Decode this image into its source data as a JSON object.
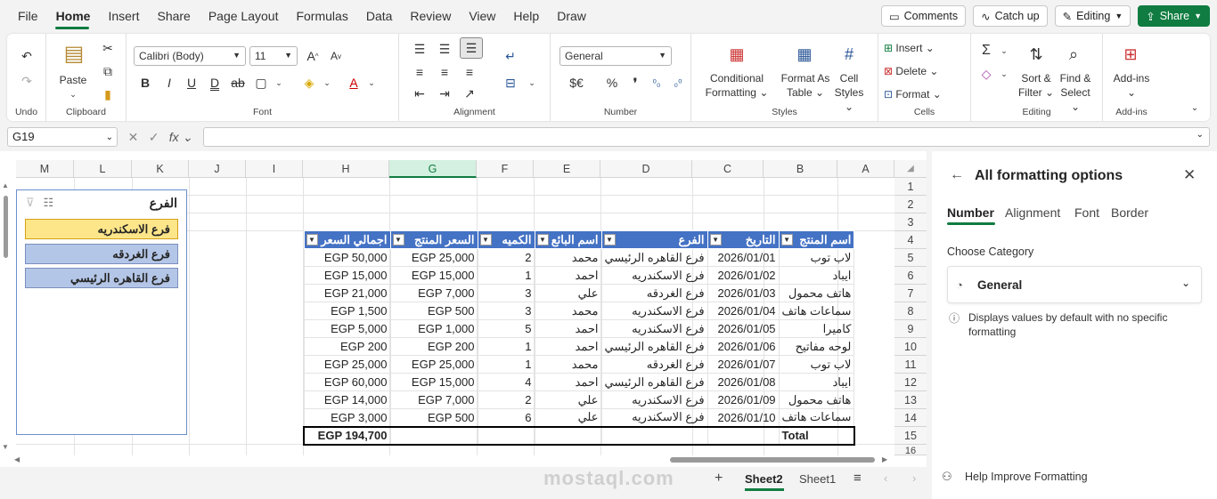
{
  "menu": [
    "File",
    "Home",
    "Insert",
    "Share",
    "Page Layout",
    "Formulas",
    "Data",
    "Review",
    "View",
    "Help",
    "Draw"
  ],
  "top_buttons": {
    "comments": "Comments",
    "catchup": "Catch up",
    "editing": "Editing",
    "share": "Share"
  },
  "ribbon": {
    "undo_label": "Undo",
    "clipboard": {
      "paste": "Paste",
      "label": "Clipboard"
    },
    "font": {
      "name": "Calibri (Body)",
      "size": "11",
      "label": "Font"
    },
    "alignment_label": "Alignment",
    "number": {
      "format": "General",
      "label": "Number"
    },
    "styles": {
      "cond": "Conditional",
      "cond2": "Formatting",
      "fmt_as": "Format As",
      "fmt_as2": "Table",
      "cell": "Cell",
      "cell2": "Styles",
      "label": "Styles"
    },
    "cells": {
      "insert": "Insert",
      "delete": "Delete",
      "format": "Format",
      "label": "Cells"
    },
    "editing": {
      "sort": "Sort &",
      "sort2": "Filter",
      "find": "Find &",
      "find2": "Select",
      "label": "Editing"
    },
    "addins": {
      "btn": "Add-ins",
      "label": "Add-ins"
    }
  },
  "namebox": "G19",
  "columns": [
    "M",
    "L",
    "K",
    "J",
    "I",
    "H",
    "G",
    "F",
    "E",
    "D",
    "C",
    "B",
    "A"
  ],
  "rows": [
    "1",
    "2",
    "3",
    "4",
    "5",
    "6",
    "7",
    "8",
    "9",
    "10",
    "11",
    "12",
    "13",
    "14",
    "15",
    "16"
  ],
  "table": {
    "headers": [
      "اجمالي السعر",
      "السعر المنتج",
      "الكميه",
      "اسم البائع",
      "الفرع",
      "التاريخ",
      "اسم المنتج"
    ],
    "rows": [
      [
        "EGP 50,000",
        "EGP 25,000",
        "2",
        "محمد",
        "فرع القاهره الرئيسي",
        "2026/01/01",
        "لاب توب"
      ],
      [
        "EGP 15,000",
        "EGP 15,000",
        "1",
        "احمد",
        "فرع الاسكندريه",
        "2026/01/02",
        "ايباد"
      ],
      [
        "EGP 21,000",
        "EGP 7,000",
        "3",
        "علي",
        "فرع الغردقه",
        "2026/01/03",
        "هاتف محمول"
      ],
      [
        "EGP 1,500",
        "EGP 500",
        "3",
        "محمد",
        "فرع الاسكندريه",
        "2026/01/04",
        "سماعات هاتف"
      ],
      [
        "EGP 5,000",
        "EGP 1,000",
        "5",
        "احمد",
        "فرع الاسكندريه",
        "2026/01/05",
        "كاميرا"
      ],
      [
        "EGP 200",
        "EGP 200",
        "1",
        "احمد",
        "فرع القاهره الرئيسي",
        "2026/01/06",
        "لوحه مفاتيح"
      ],
      [
        "EGP 25,000",
        "EGP 25,000",
        "1",
        "محمد",
        "فرع الغردقه",
        "2026/01/07",
        "لاب توب"
      ],
      [
        "EGP 60,000",
        "EGP 15,000",
        "4",
        "احمد",
        "فرع القاهره الرئيسي",
        "2026/01/08",
        "ايباد"
      ],
      [
        "EGP 14,000",
        "EGP 7,000",
        "2",
        "علي",
        "فرع الاسكندريه",
        "2026/01/09",
        "هاتف محمول"
      ],
      [
        "EGP 3,000",
        "EGP 500",
        "6",
        "علي",
        "فرع الاسكندريه",
        "2026/01/10",
        "سماعات هاتف"
      ]
    ],
    "total_value": "EGP 194,700",
    "total_label": "Total"
  },
  "slicer": {
    "title": "الفرع",
    "items": [
      "فرع الاسكندريه",
      "فرع الغردقه",
      "فرع القاهره الرئيسي"
    ]
  },
  "pane": {
    "title": "All formatting options",
    "tabs": [
      "Number",
      "Alignment",
      "Font",
      "Border"
    ],
    "category_label": "Choose Category",
    "category_value": "General",
    "info": "Displays values by default with no specific formatting",
    "help": "Help Improve Formatting"
  },
  "sheets": [
    "Sheet2",
    "Sheet1"
  ],
  "watermark": "mostaql.com",
  "colors": {
    "accent": "#107c41",
    "table_header": "#4472c4",
    "slicer_selected": "#fde68a",
    "slicer_item": "#b4c6e7"
  }
}
